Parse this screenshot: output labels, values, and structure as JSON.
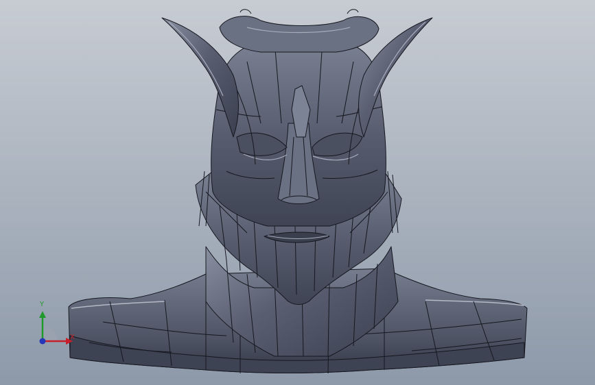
{
  "viewport": {
    "background_top": "#c7ccd3",
    "background_bottom": "#8d99a9",
    "model_fill": "#595f71",
    "model_highlight": "#a7adbb",
    "model_shadow": "#2f3341",
    "edge_color": "#15171f"
  },
  "model": {
    "name": "sculpted-bust",
    "icon": "bust-model"
  },
  "triad": {
    "x_label": "X",
    "y_label": "Y",
    "x_color": "#c8202a",
    "y_color": "#1f9a2a",
    "z_color": "#2636b8"
  }
}
